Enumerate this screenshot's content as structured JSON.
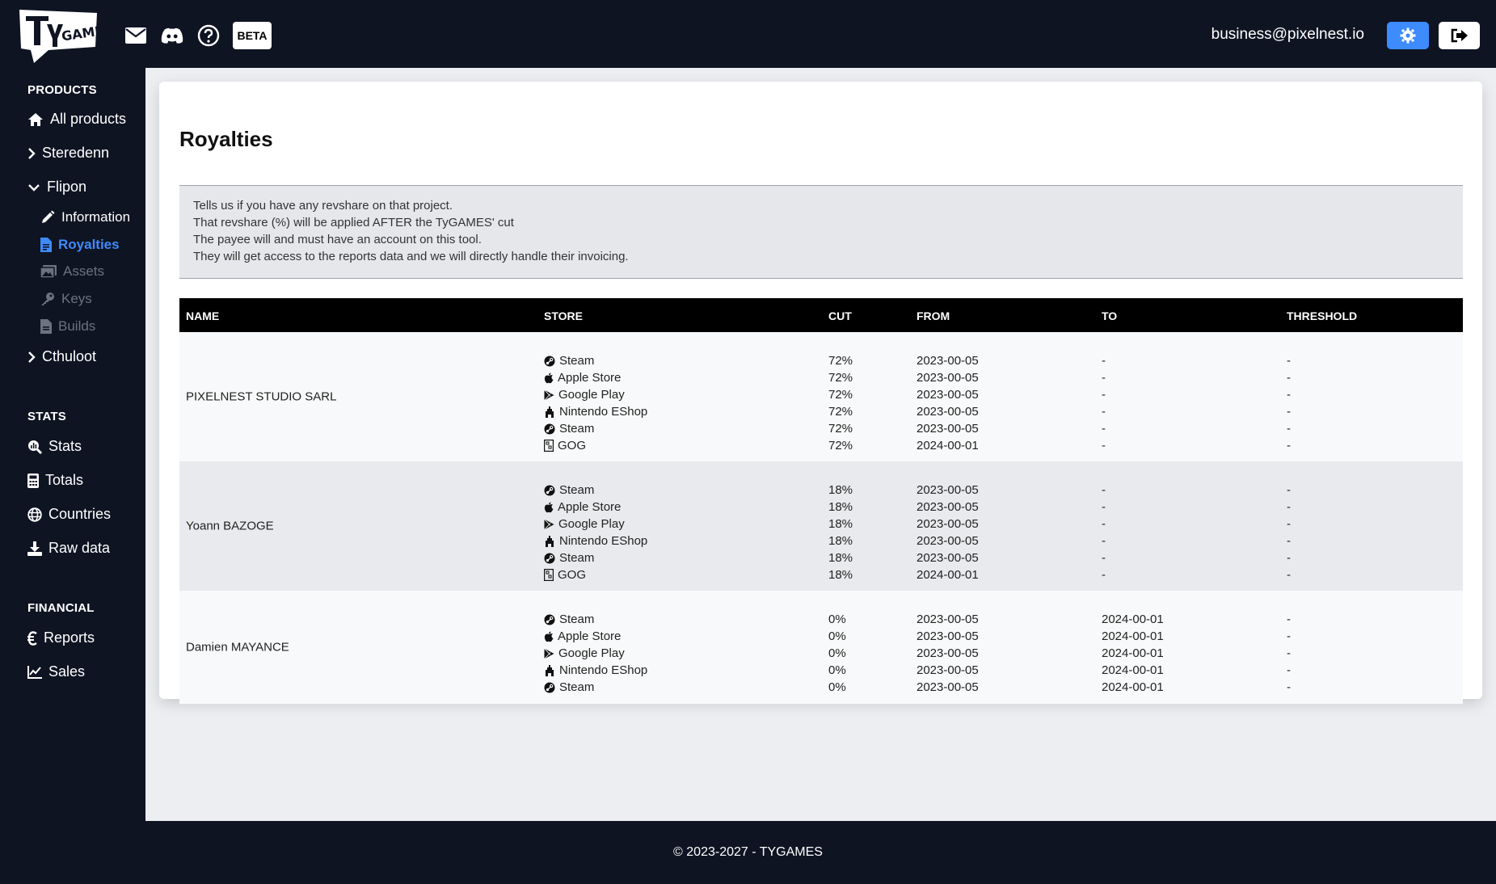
{
  "header": {
    "logo_text": "TyGAMES",
    "beta_label": "BETA",
    "user_email": "business@pixelnest.io",
    "icons": [
      "envelope-icon",
      "discord-icon",
      "help-icon"
    ]
  },
  "sidebar": {
    "sections": [
      {
        "title": "PRODUCTS"
      },
      {
        "title": "STATS"
      },
      {
        "title": "FINANCIAL"
      }
    ],
    "products": {
      "all_products": "All products",
      "steredenn": "Steredenn",
      "flipon": "Flipon",
      "flipon_sub": {
        "information": "Information",
        "royalties": "Royalties",
        "assets": "Assets",
        "keys": "Keys",
        "builds": "Builds"
      },
      "cthuloot": "Cthuloot"
    },
    "stats": {
      "stats": "Stats",
      "totals": "Totals",
      "countries": "Countries",
      "raw_data": "Raw data"
    },
    "financial": {
      "reports": "Reports",
      "sales": "Sales"
    }
  },
  "main": {
    "title": "Royalties",
    "info_lines": [
      "Tells us if you have any revshare on that project.",
      "That revshare (%) will be applied AFTER the TyGAMES' cut",
      "The payee will and must have an account on this tool.",
      "They will get access to the reports data and we will directly handle their invoicing."
    ],
    "table": {
      "headers": {
        "name": "NAME",
        "store": "STORE",
        "cut": "CUT",
        "from": "FROM",
        "to": "TO",
        "threshold": "THRESHOLD"
      },
      "groups": [
        {
          "name": "PIXELNEST STUDIO SARL",
          "rows": [
            {
              "store": "Steam",
              "icon": "steam-icon",
              "cut": "72%",
              "from": "2023-00-05",
              "to": "-",
              "threshold": "-"
            },
            {
              "store": "Apple Store",
              "icon": "apple-icon",
              "cut": "72%",
              "from": "2023-00-05",
              "to": "-",
              "threshold": "-"
            },
            {
              "store": "Google Play",
              "icon": "google-play-icon",
              "cut": "72%",
              "from": "2023-00-05",
              "to": "-",
              "threshold": "-"
            },
            {
              "store": "Nintendo EShop",
              "icon": "nintendo-icon",
              "cut": "72%",
              "from": "2023-00-05",
              "to": "-",
              "threshold": "-"
            },
            {
              "store": "Steam",
              "icon": "steam-icon",
              "cut": "72%",
              "from": "2023-00-05",
              "to": "-",
              "threshold": "-"
            },
            {
              "store": "GOG",
              "icon": "gog-icon",
              "cut": "72%",
              "from": "2024-00-01",
              "to": "-",
              "threshold": "-"
            }
          ]
        },
        {
          "name": "Yoann BAZOGE",
          "rows": [
            {
              "store": "Steam",
              "icon": "steam-icon",
              "cut": "18%",
              "from": "2023-00-05",
              "to": "-",
              "threshold": "-"
            },
            {
              "store": "Apple Store",
              "icon": "apple-icon",
              "cut": "18%",
              "from": "2023-00-05",
              "to": "-",
              "threshold": "-"
            },
            {
              "store": "Google Play",
              "icon": "google-play-icon",
              "cut": "18%",
              "from": "2023-00-05",
              "to": "-",
              "threshold": "-"
            },
            {
              "store": "Nintendo EShop",
              "icon": "nintendo-icon",
              "cut": "18%",
              "from": "2023-00-05",
              "to": "-",
              "threshold": "-"
            },
            {
              "store": "Steam",
              "icon": "steam-icon",
              "cut": "18%",
              "from": "2023-00-05",
              "to": "-",
              "threshold": "-"
            },
            {
              "store": "GOG",
              "icon": "gog-icon",
              "cut": "18%",
              "from": "2024-00-01",
              "to": "-",
              "threshold": "-"
            }
          ]
        },
        {
          "name": "Damien MAYANCE",
          "rows": [
            {
              "store": "Steam",
              "icon": "steam-icon",
              "cut": "0%",
              "from": "2023-00-05",
              "to": "2024-00-01",
              "threshold": "-"
            },
            {
              "store": "Apple Store",
              "icon": "apple-icon",
              "cut": "0%",
              "from": "2023-00-05",
              "to": "2024-00-01",
              "threshold": "-"
            },
            {
              "store": "Google Play",
              "icon": "google-play-icon",
              "cut": "0%",
              "from": "2023-00-05",
              "to": "2024-00-01",
              "threshold": "-"
            },
            {
              "store": "Nintendo EShop",
              "icon": "nintendo-icon",
              "cut": "0%",
              "from": "2023-00-05",
              "to": "2024-00-01",
              "threshold": "-"
            },
            {
              "store": "Steam",
              "icon": "steam-icon",
              "cut": "0%",
              "from": "2023-00-05",
              "to": "2024-00-01",
              "threshold": "-"
            }
          ]
        }
      ]
    }
  },
  "footer": {
    "text": "© 2023-2027 - TYGAMES"
  },
  "colors": {
    "background_dark": "#0f1423",
    "accent_blue": "#3d8bfd",
    "page_bg": "#eceef2",
    "table_header": "#000000"
  }
}
